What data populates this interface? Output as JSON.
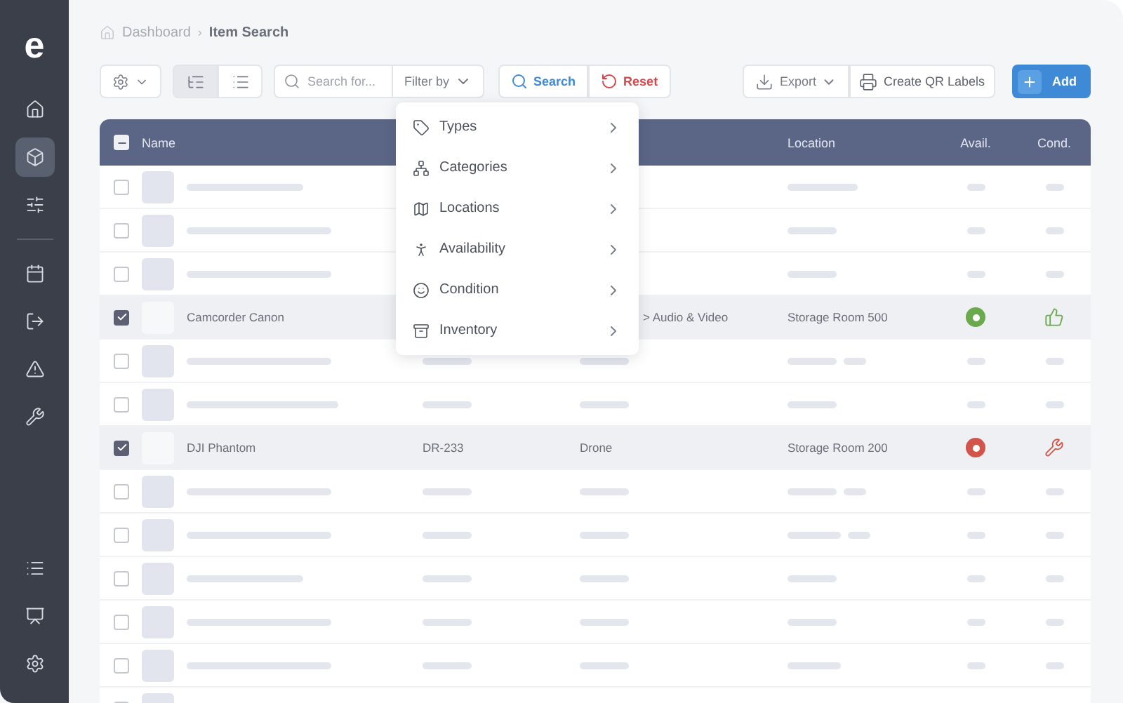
{
  "sidebar": {
    "logo": "e",
    "top_items": [
      {
        "selected": false
      },
      {
        "selected": true
      },
      {
        "selected": false
      }
    ],
    "middle_items": [
      {
        "selected": false
      },
      {
        "selected": false
      },
      {
        "selected": false
      },
      {
        "selected": false
      }
    ],
    "bottom_items": [
      {
        "selected": false
      },
      {
        "selected": false
      },
      {
        "selected": false
      }
    ]
  },
  "breadcrumb": {
    "parent": "Dashboard",
    "separator": "›",
    "current": "Item Search"
  },
  "toolbar": {
    "views": [
      {
        "kind": "tree",
        "selected": true
      },
      {
        "kind": "list",
        "selected": false
      }
    ],
    "search": {
      "placeholder": "Search for..."
    },
    "filter_label": "Filter by",
    "search_button": "Search",
    "reset_button": "Reset",
    "export_button": "Export",
    "qr_button": "Create QR Labels",
    "add_button": "Add"
  },
  "filter_menu": [
    {
      "kind": "tag",
      "label": "Types"
    },
    {
      "kind": "hierarchy",
      "label": "Categories"
    },
    {
      "kind": "map",
      "label": "Locations"
    },
    {
      "kind": "walk",
      "label": "Availability"
    },
    {
      "kind": "smile",
      "label": "Condition"
    },
    {
      "kind": "archive",
      "label": "Inventory"
    }
  ],
  "table": {
    "header_checkbox": {
      "partial": true
    },
    "name_header": "Name",
    "location_header": "Location",
    "avail_header": "Avail.",
    "cond_header": "Cond.",
    "rows": [
      {
        "kind": "placeholder",
        "checked": false
      },
      {
        "kind": "placeholder",
        "checked": false
      },
      {
        "kind": "placeholder",
        "checked": false
      },
      {
        "kind": "item",
        "checked": true,
        "name": "Camcorder Canon",
        "category": "> Audio & Video",
        "location": "Storage Room 500",
        "avail": {
          "color": "#6aaa4c"
        },
        "cond": {
          "kind": "thumbs_up"
        }
      },
      {
        "kind": "placeholder",
        "checked": false
      },
      {
        "kind": "placeholder",
        "checked": false
      },
      {
        "kind": "item",
        "checked": true,
        "name": "DJI Phantom",
        "code": "DR-233",
        "category": "Drone",
        "location": "Storage Room 200",
        "avail": {
          "color": "#d2554b"
        },
        "cond": {
          "kind": "wrench"
        }
      },
      {
        "kind": "placeholder",
        "checked": false
      },
      {
        "kind": "placeholder",
        "checked": false
      },
      {
        "kind": "placeholder",
        "checked": false
      },
      {
        "kind": "placeholder",
        "checked": false
      },
      {
        "kind": "placeholder",
        "checked": false
      },
      {
        "kind": "placeholder",
        "checked": false
      }
    ]
  }
}
